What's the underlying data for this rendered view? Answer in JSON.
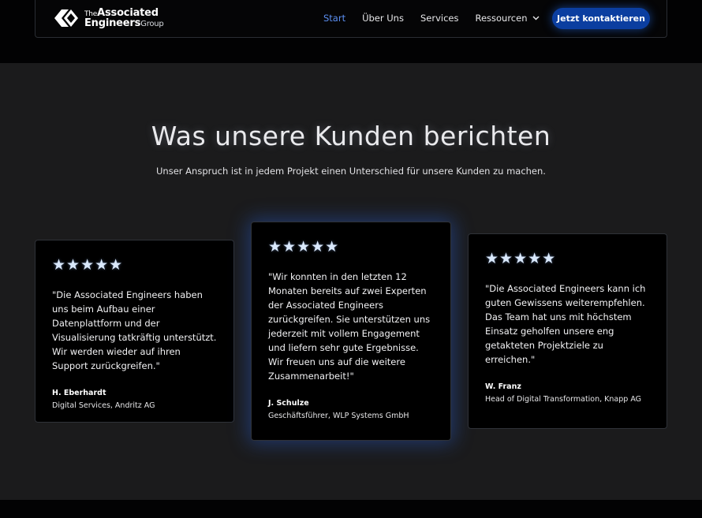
{
  "brand": {
    "logo_line1_prefix": "The",
    "logo_line1_main": "Associated",
    "logo_line2_main": "Engineers",
    "logo_line2_suffix": "Group"
  },
  "nav": {
    "items": [
      {
        "label": "Start",
        "active": true
      },
      {
        "label": "Über Uns"
      },
      {
        "label": "Services"
      },
      {
        "label": "Ressourcen",
        "icon": "chevron-down-icon"
      }
    ],
    "cta_label": "Jetzt kontaktieren"
  },
  "section": {
    "title": "Was unsere Kunden berichten",
    "subtitle": "Unser Anspruch ist in jedem Projekt einen Unterschied für unsere Kunden zu machen."
  },
  "testimonials": [
    {
      "stars": "★★★★★",
      "rating": 5,
      "quote": "\"Die Associated Engineers haben uns beim Aufbau einer Datenplattform und der Visualisierung tatkräftig unterstützt. Wir werden wieder auf ihren Support zurückgreifen.\"",
      "author": "H. Eberhardt",
      "role": "Digital Services, Andritz AG"
    },
    {
      "stars": "★★★★★",
      "rating": 5,
      "quote": "\"Wir konnten in den letzten 12 Monaten bereits auf zwei Experten der Associated Engineers zurückgreifen. Sie unterstützen uns jederzeit mit vollem Engagement und liefern sehr gute Ergebnisse. Wir freuen uns auf die weitere Zusammenarbeit!\"",
      "author": "J. Schulze",
      "role": "Geschäftsführer, WLP Systems GmbH"
    },
    {
      "stars": "★★★★★",
      "rating": 5,
      "quote": "\"Die Associated Engineers kann ich guten Gewissens weiterempfehlen. Das Team hat uns mit höchstem Einsatz geholfen unsere eng getakteten Projektziele zu erreichen.\"",
      "author": "W. Franz",
      "role": "Head of Digital Transformation, Knapp AG"
    }
  ],
  "colors": {
    "accent": "#5c8ff2",
    "cta_bg": "#0b3ea0",
    "section_bg": "#1b1b1c",
    "card_bg": "#000000"
  }
}
